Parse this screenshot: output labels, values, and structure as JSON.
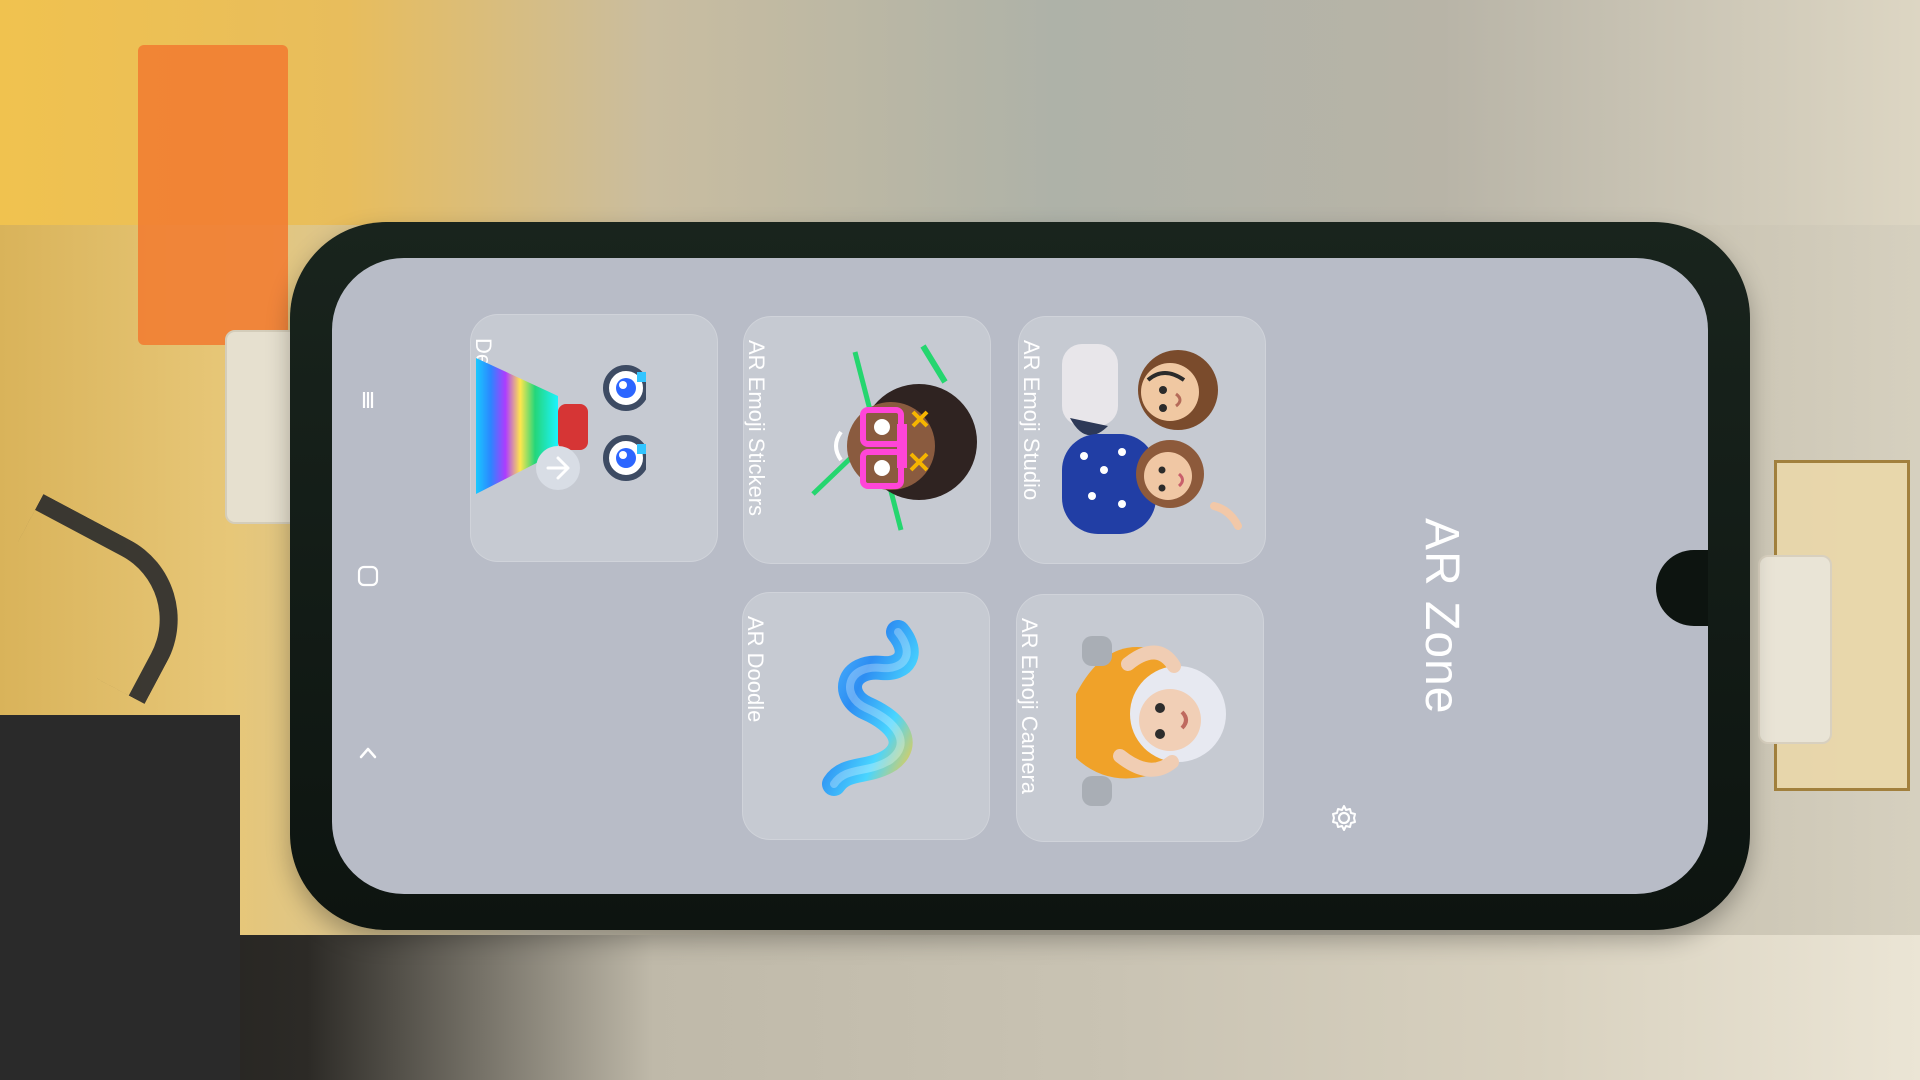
{
  "header": {
    "title": "AR Zone"
  },
  "nav": {
    "items": [
      {
        "name": "recents",
        "icon": "recents-icon"
      },
      {
        "name": "home",
        "icon": "home-icon"
      },
      {
        "name": "back",
        "icon": "back-icon"
      }
    ]
  },
  "settings": {
    "icon": "gear-icon"
  },
  "cards": [
    {
      "label": "Deco Pic",
      "icon": "deco-pic-icon"
    },
    {
      "label": "AR Emoji Stickers",
      "icon": "ar-emoji-stickers-icon"
    },
    {
      "label": "AR Emoji Studio",
      "icon": "ar-emoji-studio-icon"
    },
    {
      "label": "AR Doodle",
      "icon": "ar-doodle-icon"
    },
    {
      "label": "AR Emoji Camera",
      "icon": "ar-emoji-camera-icon"
    }
  ],
  "colors": {
    "screen_background": "#b8bcc7",
    "card_background": "#c6cad2",
    "text": "#ffffff",
    "phone_frame": "#19241d"
  }
}
